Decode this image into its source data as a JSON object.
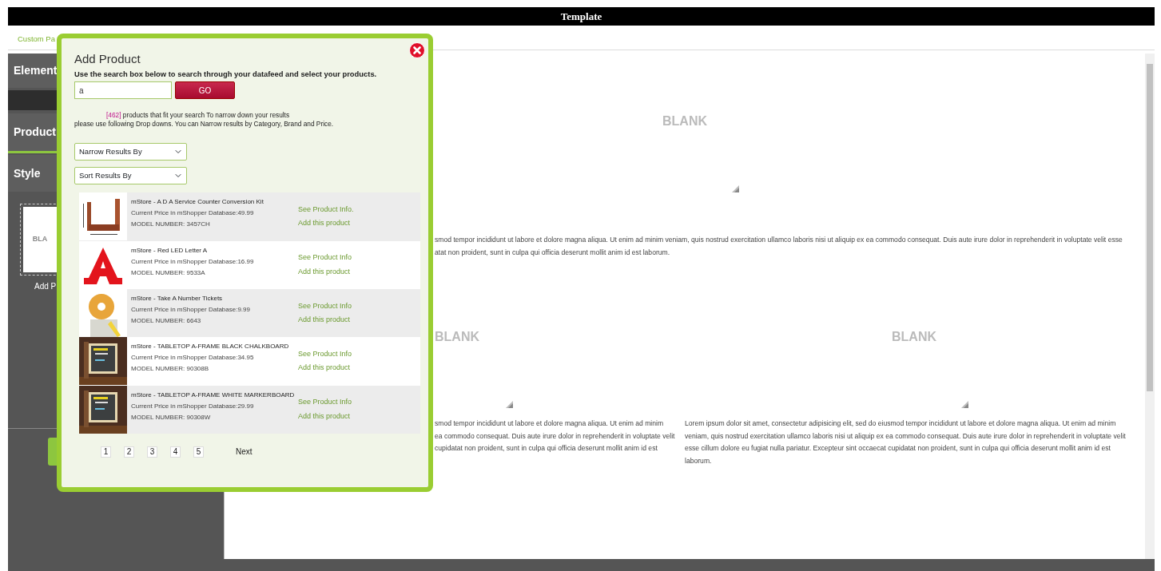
{
  "window": {
    "title": "Template"
  },
  "tabs": [
    {
      "label": "Custom Pa"
    }
  ],
  "sidebar": {
    "sections": [
      {
        "label": "Element",
        "selected": false
      },
      {
        "label": "Product",
        "selected": true
      },
      {
        "label": "Style",
        "selected": false
      }
    ],
    "thumbnail": {
      "label": "BLA",
      "caption": "Add P"
    }
  },
  "canvas": {
    "rows": [
      {
        "cells": [
          {
            "label": "BLANK",
            "lines": [
              "smod tempor incididunt ut labore et dolore magna aliqua. Ut enim ad minim veniam, quis nostrud exercitation ullamco laboris nisi ut aliquip ex ea commodo consequat. Duis aute irure dolor in reprehenderit in voluptate velit esse",
              "atat non proident, sunt in culpa qui officia deserunt mollit anim id est laborum."
            ]
          }
        ]
      },
      {
        "cells": [
          {
            "label": "BLANK",
            "lines": [
              "smod tempor incididunt ut labore et dolore magna aliqua. Ut enim ad minim",
              "ea commodo consequat. Duis aute irure dolor in reprehenderit in voluptate velit",
              "cupidatat non proident, sunt in culpa qui officia deserunt mollit anim id est"
            ]
          },
          {
            "label": "BLANK",
            "lines": [
              "Lorem ipsum dolor sit amet, consectetur adipisicing elit, sed do eiusmod tempor incididunt ut labore et dolore magna aliqua. Ut enim ad minim",
              "veniam, quis nostrud exercitation ullamco laboris nisi ut aliquip ex ea commodo consequat. Duis aute irure dolor in reprehenderit in voluptate velit",
              "esse cillum dolore eu fugiat nulla pariatur. Excepteur sint occaecat cupidatat non proident, sunt in culpa qui officia deserunt mollit anim id est",
              "laborum."
            ]
          }
        ]
      }
    ]
  },
  "dialog": {
    "title": "Add Product",
    "instructions": "Use the search box below to search through your datafeed and select your products.",
    "search": {
      "value": "a"
    },
    "go_button": "GO",
    "results_count": "[462]",
    "results_text": "products that fit your search To narrow down your results",
    "results_hint": "please use following Drop downs. You can Narrow results by Category, Brand and Price.",
    "filters": [
      {
        "label": "Narrow Results By"
      },
      {
        "label": "Sort Results By"
      }
    ],
    "products": [
      {
        "title": "mStore - A D A Service Counter Conversion Kit",
        "price": "Current Price in mShopper Database:49.99",
        "model": "MODEL NUMBER: 3457CH",
        "info_link": "See Product Info.",
        "add_link": "Add this product"
      },
      {
        "title": "mStore - Red LED Letter A",
        "price": "Current Price in mShopper Database:16.99",
        "model": "MODEL NUMBER: 9533A",
        "info_link": "See Product Info",
        "add_link": "Add this product"
      },
      {
        "title": "mStore - Take A Number Tickets",
        "price": "Current Price in mShopper Database:9.99",
        "model": "MODEL NUMBER: 6643",
        "info_link": "See Product Info",
        "add_link": "Add this product"
      },
      {
        "title": "mStore - TABLETOP A-FRAME BLACK CHALKBOARD",
        "price": "Current Price in mShopper Database:34.95",
        "model": "MODEL NUMBER: 90308B",
        "info_link": "See Product Info",
        "add_link": "Add this product"
      },
      {
        "title": "mStore - TABLETOP A-FRAME WHITE MARKERBOARD",
        "price": "Current Price in mShopper Database:29.99",
        "model": "MODEL NUMBER: 90308W",
        "info_link": "See Product Info",
        "add_link": "Add this product"
      }
    ],
    "pages": [
      "1",
      "2",
      "3",
      "4",
      "5"
    ],
    "next": "Next"
  }
}
